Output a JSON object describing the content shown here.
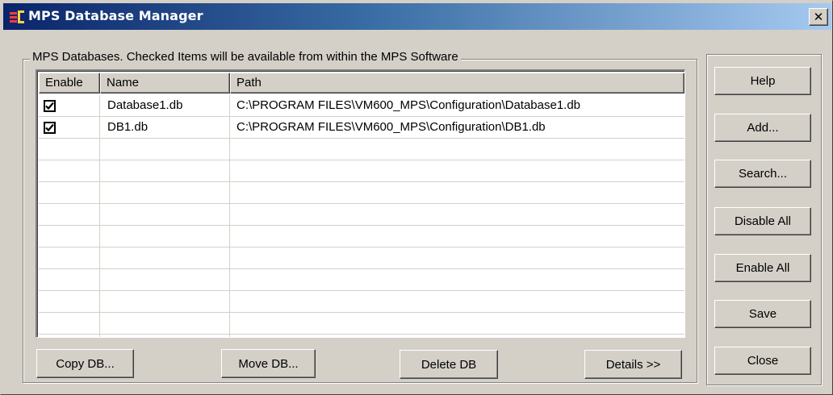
{
  "window": {
    "title": "MPS Database Manager",
    "close_symbol": "✕"
  },
  "group": {
    "label": "MPS Databases. Checked Items will be available from within the MPS Software"
  },
  "table": {
    "columns": [
      "Enable",
      "Name",
      "Path"
    ],
    "rows": [
      {
        "enabled": true,
        "name": "Database1.db",
        "path": "C:\\PROGRAM FILES\\VM600_MPS\\Configuration\\Database1.db"
      },
      {
        "enabled": true,
        "name": "DB1.db",
        "path": "C:\\PROGRAM FILES\\VM600_MPS\\Configuration\\DB1.db"
      }
    ],
    "empty_row_count": 10
  },
  "bottom_buttons": {
    "copy": "Copy DB...",
    "move": "Move DB...",
    "delete": "Delete DB",
    "details": "Details >>"
  },
  "side_buttons": {
    "help": "Help",
    "add": "Add...",
    "search": "Search...",
    "disable_all": "Disable All",
    "enable_all": "Enable All",
    "save": "Save",
    "close": "Close"
  },
  "icons": {
    "app": "mps-app-icon",
    "close": "close-icon",
    "check": "checkmark-icon"
  }
}
